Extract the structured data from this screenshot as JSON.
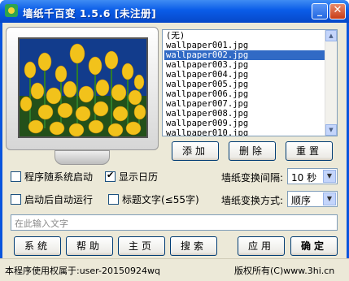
{
  "window": {
    "title": "墙纸千百变 1.5.6 [未注册]",
    "minimize_symbol": "_",
    "close_symbol": "✕"
  },
  "wallpaper_list": {
    "items": [
      "(无)",
      "wallpaper001.jpg",
      "wallpaper002.jpg",
      "wallpaper003.jpg",
      "wallpaper004.jpg",
      "wallpaper005.jpg",
      "wallpaper006.jpg",
      "wallpaper007.jpg",
      "wallpaper008.jpg",
      "wallpaper009.jpg",
      "wallpaper010.jpg"
    ],
    "selected_index": 2
  },
  "list_buttons": {
    "add": "添加",
    "delete": "删除",
    "reset": "重置"
  },
  "options": {
    "autostart_label": "程序随系统启动",
    "autostart_checked": false,
    "show_calendar_label": "显示日历",
    "show_calendar_checked": true,
    "autorun_label": "启动后自动运行",
    "autorun_checked": false,
    "title_text_label": "标题文字(≤55字)",
    "title_text_checked": false
  },
  "interval": {
    "label": "墙纸变换间隔:",
    "value": "10 秒"
  },
  "mode": {
    "label": "墙纸变换方式:",
    "value": "顺序"
  },
  "text_input": {
    "placeholder": "在此输入文字"
  },
  "bottom_buttons": {
    "system": "系统",
    "help": "帮助",
    "home": "主页",
    "search": "搜索",
    "apply": "应用",
    "ok": "确定"
  },
  "status": {
    "left": "本程序使用权属于:user-20150924wq",
    "right": "版权所有(C)www.3hi.cn"
  }
}
